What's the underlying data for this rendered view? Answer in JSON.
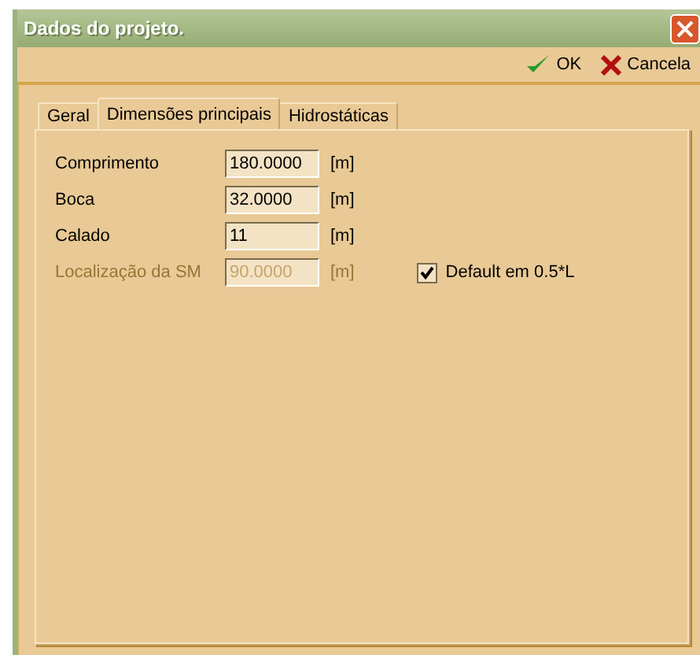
{
  "window": {
    "title": "Dados do projeto."
  },
  "toolbar": [
    {
      "kind": "ok",
      "label": "OK"
    },
    {
      "kind": "cancel",
      "label": "Cancela"
    }
  ],
  "tabs": [
    {
      "label": "Geral",
      "selected": false
    },
    {
      "label": "Dimensões principais",
      "selected": true
    },
    {
      "label": "Hidrostáticas",
      "selected": false
    }
  ],
  "fields": [
    {
      "label": "Comprimento",
      "value": "180.0000",
      "unit": "[m]",
      "disabled": false
    },
    {
      "label": "Boca",
      "value": "32.0000",
      "unit": "[m]",
      "disabled": false
    },
    {
      "label": "Calado",
      "value": "11",
      "unit": "[m]",
      "disabled": false
    },
    {
      "label": "Localização da SM",
      "value": "90.0000",
      "unit": "[m]",
      "disabled": true
    }
  ],
  "checkbox": {
    "label": "Default em 0.5*L",
    "checked": true
  }
}
